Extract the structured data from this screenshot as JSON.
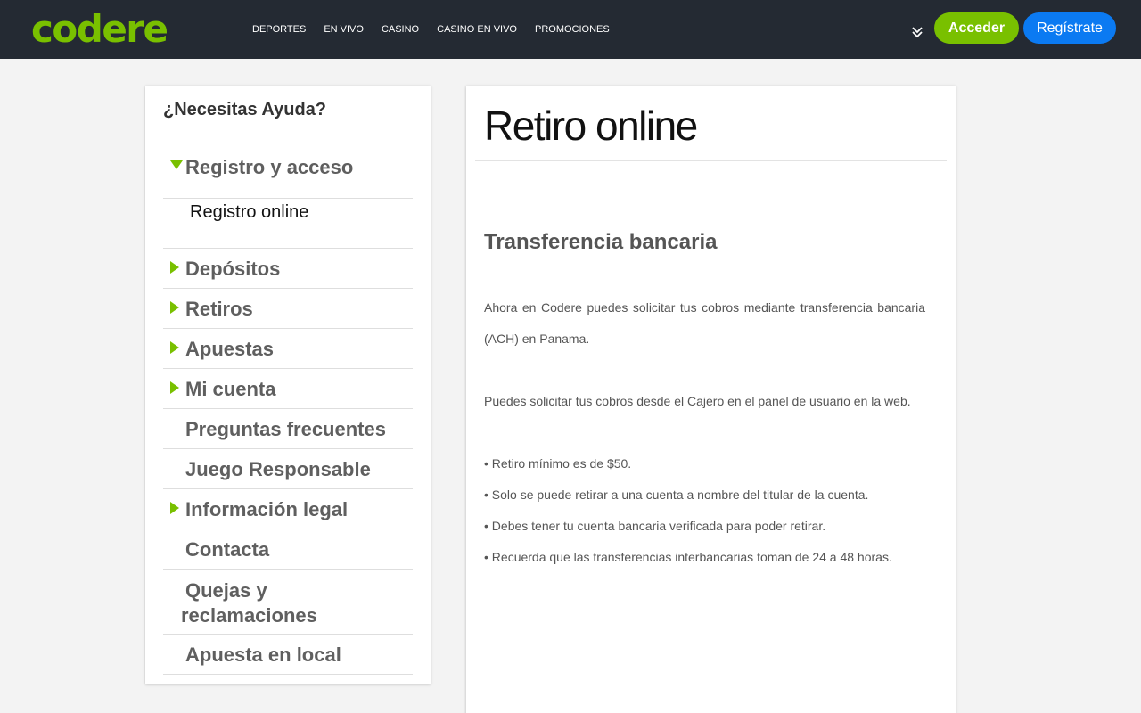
{
  "header": {
    "logo": "codere",
    "nav": [
      "DEPORTES",
      "EN VIVO",
      "CASINO",
      "CASINO EN VIVO",
      "PROMOCIONES"
    ],
    "login_label": "Acceder",
    "register_label": "Regístrate",
    "colors": {
      "bar": "#242a33",
      "brand_green": "#79c000",
      "register_blue": "#0b7af2"
    }
  },
  "sidebar": {
    "title": "¿Necesitas Ayuda?",
    "expanded": {
      "label": "Registro y acceso",
      "sub_items": [
        "Registro online"
      ]
    },
    "items": [
      "Depósitos",
      "Retiros",
      "Apuestas",
      "Mi cuenta",
      "Preguntas frecuentes",
      "Juego Responsable",
      "Información legal",
      "Contacta",
      "Quejas y reclamaciones",
      "Apuesta en local"
    ]
  },
  "content": {
    "title": "Retiro online",
    "section_title": "Transferencia bancaria",
    "paragraphs": [
      "Ahora en Codere puedes solicitar tus cobros mediante transferencia bancaria (ACH) en Panama.",
      "Puedes solicitar tus cobros desde el Cajero en el panel de usuario en la web."
    ],
    "bullets": [
      "• Retiro mínimo es de $50.",
      "• Solo se puede retirar a una cuenta a nombre del titular de la cuenta.",
      "• Debes tener tu cuenta bancaria verificada para poder retirar.",
      "• Recuerda que las transferencias interbancarias toman de 24 a 48 horas."
    ]
  }
}
